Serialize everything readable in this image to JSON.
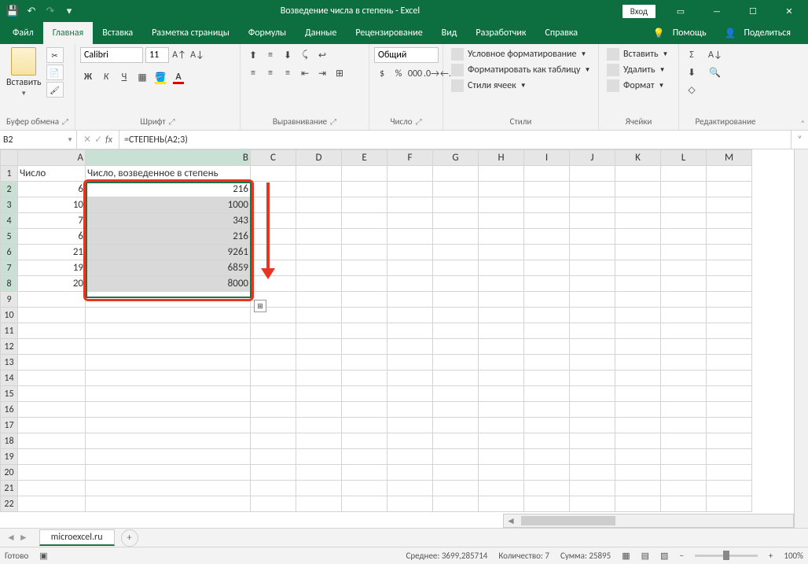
{
  "titlebar": {
    "title": "Возведение числа в степень  -  Excel",
    "login": "Вход"
  },
  "menu": {
    "file": "Файл",
    "home": "Главная",
    "insert": "Вставка",
    "layout": "Разметка страницы",
    "formulas": "Формулы",
    "data": "Данные",
    "review": "Рецензирование",
    "view": "Вид",
    "dev": "Разработчик",
    "help": "Справка",
    "tellme": "Помощь",
    "share": "Поделиться"
  },
  "ribbon": {
    "paste": "Вставить",
    "clipboard": "Буфер обмена",
    "font": "Шрифт",
    "alignment": "Выравнивание",
    "number": "Число",
    "styles": "Стили",
    "cells": "Ячейки",
    "editing": "Редактирование",
    "font_name": "Calibri",
    "font_size": "11",
    "num_format": "Общий",
    "cond_format": "Условное форматирование",
    "format_table": "Форматировать как таблицу",
    "cell_styles": "Стили ячеек",
    "insert_c": "Вставить",
    "delete_c": "Удалить",
    "format_c": "Формат"
  },
  "formula": {
    "cell": "B2",
    "value": "=СТЕПЕНЬ(A2;3)"
  },
  "sheet": {
    "cols": [
      "A",
      "B",
      "C",
      "D",
      "E",
      "F",
      "G",
      "H",
      "I",
      "J",
      "K",
      "L",
      "M"
    ],
    "h1": "Число",
    "h2": "Число, возведенное в степень",
    "rows": [
      {
        "n": 1
      },
      {
        "n": 2,
        "a": "6",
        "b": "216"
      },
      {
        "n": 3,
        "a": "10",
        "b": "1000"
      },
      {
        "n": 4,
        "a": "7",
        "b": "343"
      },
      {
        "n": 5,
        "a": "6",
        "b": "216"
      },
      {
        "n": 6,
        "a": "21",
        "b": "9261"
      },
      {
        "n": 7,
        "a": "19",
        "b": "6859"
      },
      {
        "n": 8,
        "a": "20",
        "b": "8000"
      },
      {
        "n": 9
      },
      {
        "n": 10
      },
      {
        "n": 11
      },
      {
        "n": 12
      },
      {
        "n": 13
      },
      {
        "n": 14
      },
      {
        "n": 15
      },
      {
        "n": 16
      },
      {
        "n": 17
      },
      {
        "n": 18
      },
      {
        "n": 19
      },
      {
        "n": 20
      },
      {
        "n": 21
      },
      {
        "n": 22
      }
    ],
    "tab": "microexcel.ru"
  },
  "status": {
    "ready": "Готово",
    "avg_lbl": "Среднее:",
    "avg": "3699,285714",
    "cnt_lbl": "Количество:",
    "cnt": "7",
    "sum_lbl": "Сумма:",
    "sum": "25895",
    "zoom": "100%"
  }
}
